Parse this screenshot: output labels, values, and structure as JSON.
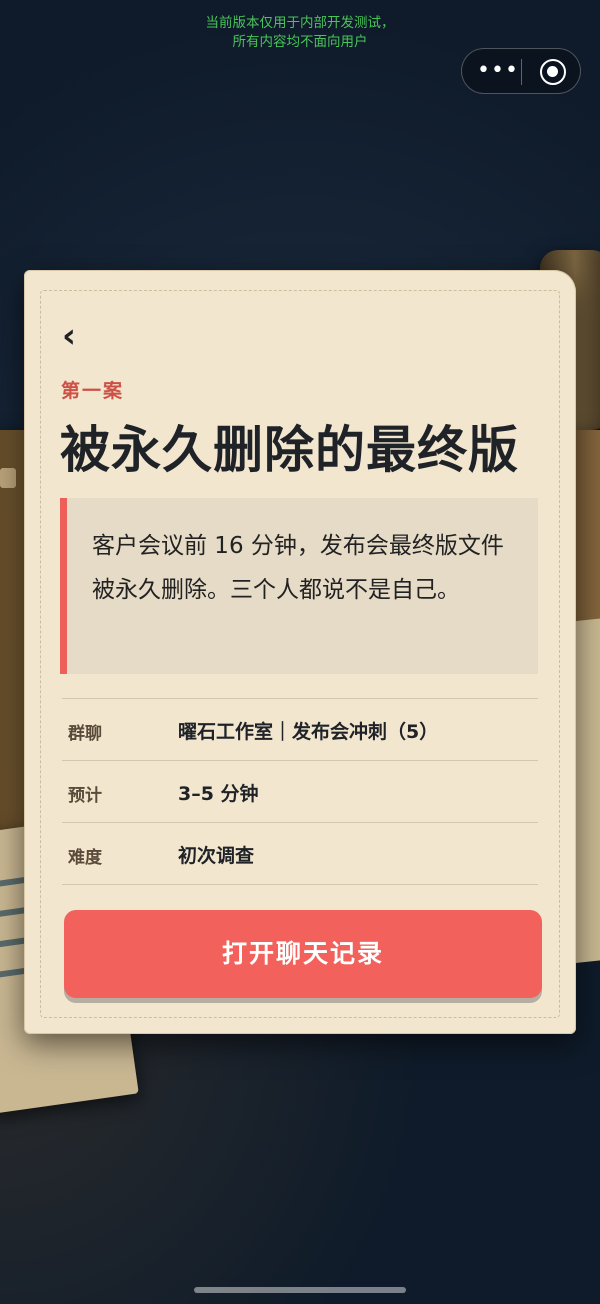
{
  "notice": {
    "line1": "当前版本仅用于内部开发测试，",
    "line2": "所有内容均不面向用户"
  },
  "capsule": {
    "more_icon": "more-dots-icon",
    "close_icon": "target-circle-icon"
  },
  "case": {
    "label": "第一案",
    "title": "被永久删除的最终版",
    "summary": "客户会议前 16 分钟，发布会最终版文件被永久删除。三个人都说不是自己。"
  },
  "info": [
    {
      "key": "群聊",
      "value": "曜石工作室｜发布会冲刺（5）"
    },
    {
      "key": "预计",
      "value": "3–5 分钟"
    },
    {
      "key": "难度",
      "value": "初次调查"
    }
  ],
  "cta": {
    "label": "打开聊天记录"
  },
  "colors": {
    "accent": "#f2615b",
    "card": "#f2e6cf",
    "label_red": "#cc5147",
    "notice_green": "#49c35a"
  }
}
